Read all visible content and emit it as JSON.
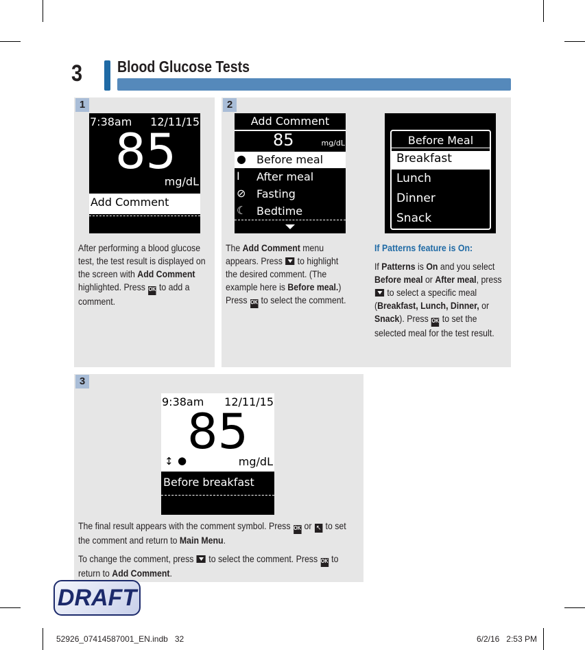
{
  "header": {
    "chapter": "3",
    "title": "Blood Glucose Tests",
    "accent": "#1f6aa5",
    "bar_color": "#5589bb"
  },
  "step1": {
    "badge": "1",
    "screen": {
      "time": "7:38am",
      "date": "12/11/15",
      "value": "85",
      "unit": "mg/dL",
      "item": "Add Comment"
    },
    "text": [
      [
        [
          "t",
          "After performing a blood glucose test, the test result is displayed on the screen with "
        ],
        [
          "b",
          "Add Comment"
        ],
        [
          "t",
          " highlighted. Press "
        ],
        [
          "i",
          "ok"
        ],
        [
          "t",
          " to add a comment."
        ]
      ]
    ]
  },
  "step2": {
    "badge": "2",
    "screen": {
      "header": "Add Comment",
      "value": "85",
      "unit": "mg/dL",
      "items": [
        {
          "icon": "apple-icon",
          "label": "Before meal",
          "selected": true
        },
        {
          "icon": "apple-core-icon",
          "label": "After meal"
        },
        {
          "icon": "no-symbol-icon",
          "label": "Fasting"
        },
        {
          "icon": "moon-icon",
          "label": "Bedtime"
        }
      ]
    },
    "text": [
      [
        [
          "t",
          "The "
        ],
        [
          "b",
          "Add Comment"
        ],
        [
          "t",
          " menu appears. Press "
        ],
        [
          "i",
          "down"
        ],
        [
          "t",
          " to highlight the  desired comment. (The example here is "
        ],
        [
          "b",
          "Before meal."
        ],
        [
          "t",
          ") Press "
        ],
        [
          "i",
          "ok"
        ],
        [
          "t",
          " to select the comment."
        ]
      ]
    ],
    "screen_b": {
      "header": "Before Meal",
      "items": [
        {
          "label": "Breakfast",
          "selected": true
        },
        {
          "label": "Lunch"
        },
        {
          "label": "Dinner"
        },
        {
          "label": "Snack"
        }
      ]
    },
    "note_title": "If Patterns feature is On:",
    "note": [
      [
        [
          "t",
          "If "
        ],
        [
          "b",
          "Patterns"
        ],
        [
          "t",
          " is "
        ],
        [
          "b",
          "On"
        ],
        [
          "t",
          " and you select "
        ],
        [
          "b",
          "Before meal"
        ],
        [
          "t",
          " or "
        ],
        [
          "b",
          "After meal"
        ],
        [
          "t",
          ", press "
        ],
        [
          "i",
          "down"
        ],
        [
          "t",
          " to select a specific meal ("
        ],
        [
          "b",
          "Breakfast, Lunch, Dinner,"
        ],
        [
          "t",
          " or "
        ],
        [
          "b",
          "Snack"
        ],
        [
          "t",
          "). Press "
        ],
        [
          "i",
          "ok"
        ],
        [
          "t",
          " to set the selected meal for the test result."
        ]
      ]
    ]
  },
  "step3": {
    "badge": "3",
    "screen": {
      "time": "9:38am",
      "date": "12/11/15",
      "value": "85",
      "unit": "mg/dL",
      "comment": "Before breakfast"
    },
    "text": [
      [
        [
          "t",
          "The final result appears with the comment symbol. Press "
        ],
        [
          "i",
          "ok"
        ],
        [
          "t",
          " or "
        ],
        [
          "i",
          "back"
        ],
        [
          "t",
          " to set the comment and return to "
        ],
        [
          "b",
          "Main Menu"
        ],
        [
          "t",
          "."
        ]
      ],
      [
        [
          "t",
          "To change the comment, press "
        ],
        [
          "i",
          "down"
        ],
        [
          "t",
          "  to select the comment. Press "
        ],
        [
          "i",
          "ok"
        ],
        [
          "t",
          " to return to "
        ],
        [
          "b",
          "Add Comment"
        ],
        [
          "t",
          "."
        ]
      ]
    ]
  },
  "footer": {
    "draft": "DRAFT",
    "page_number": "32",
    "file": "52926_07414587001_EN.indb   32",
    "timestamp": "6/2/16   2:53 PM"
  }
}
